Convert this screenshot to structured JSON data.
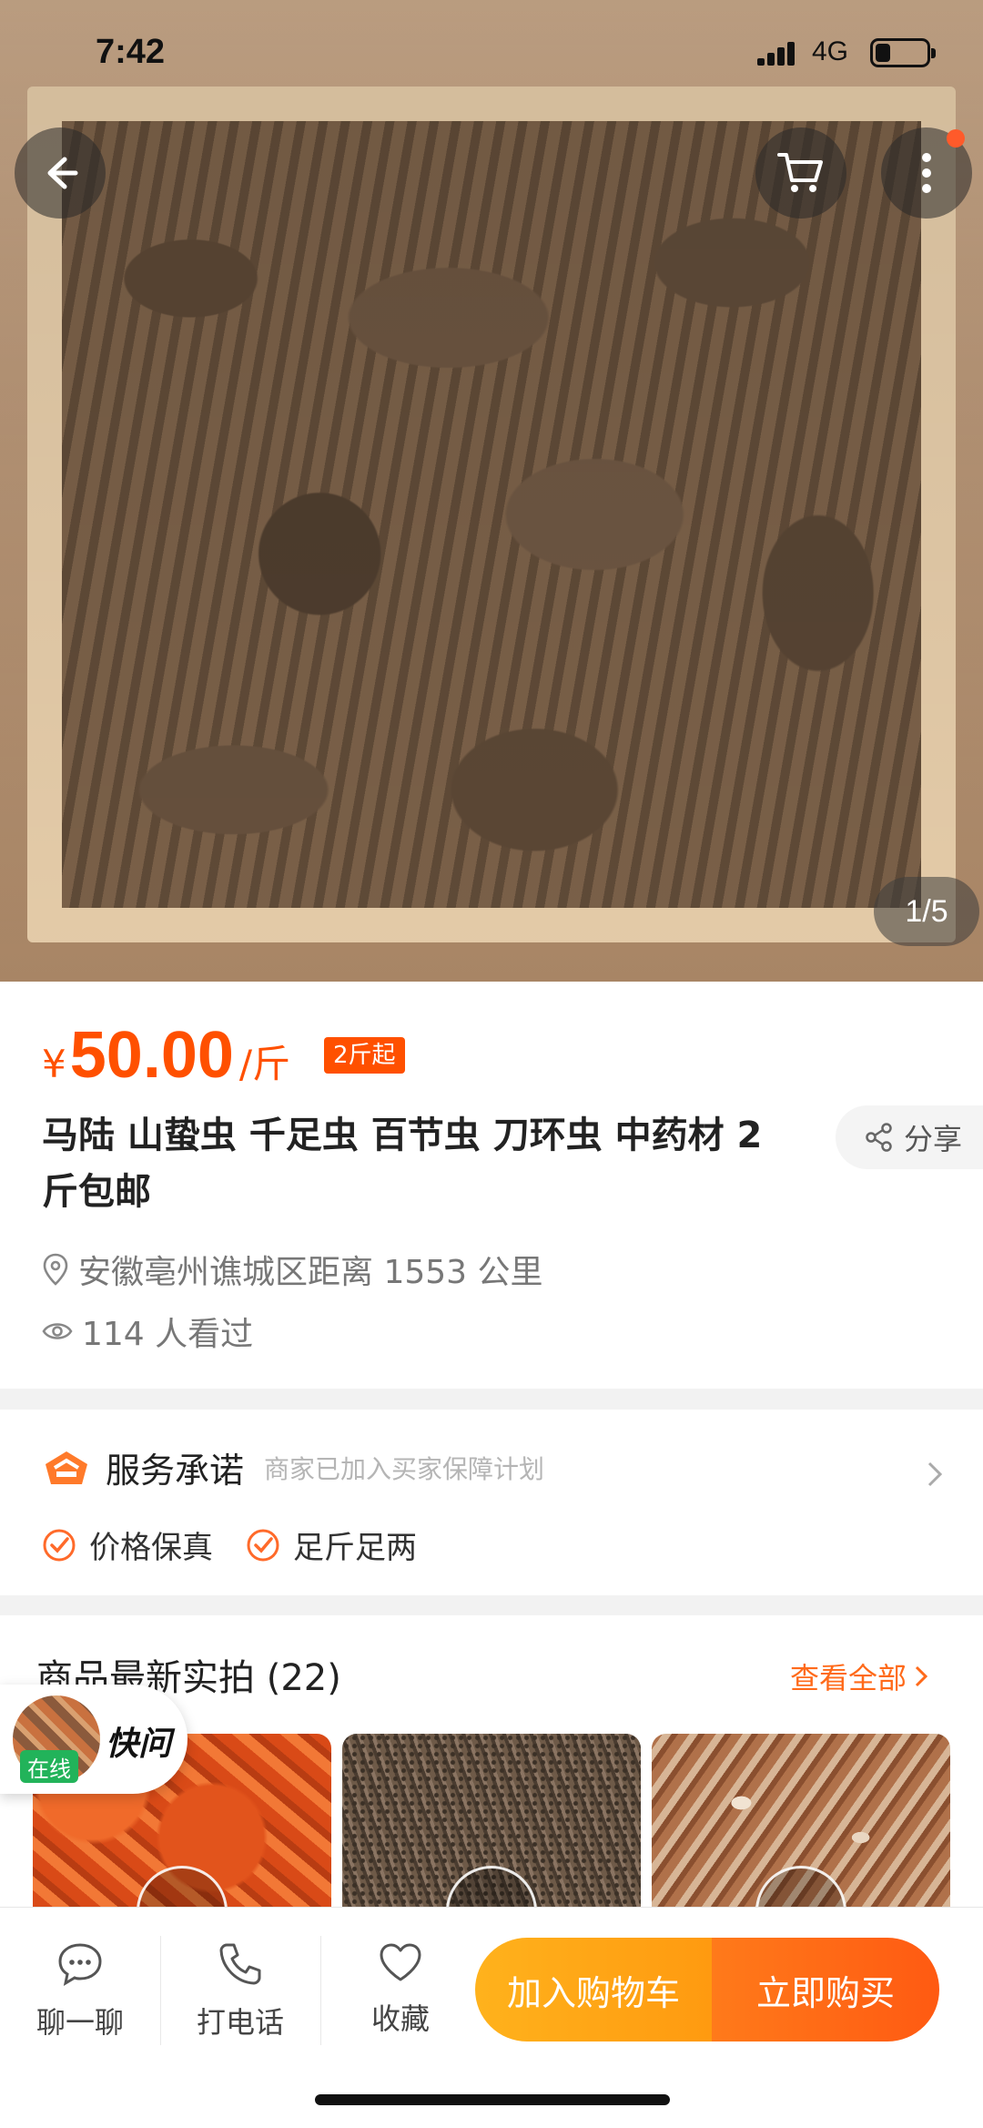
{
  "status": {
    "time": "7:42",
    "network": "4G"
  },
  "gallery": {
    "indicator": "1/5"
  },
  "product": {
    "currency": "¥",
    "price": "50.00",
    "unit": "/斤",
    "min_badge": "2斤起",
    "title": "马陆 山蛰虫 千足虫 百节虫 刀环虫 中药材 2 斤包邮",
    "share_label": "分享",
    "location": "安徽亳州谯城区距离 1553 公里",
    "views": "114 人看过"
  },
  "service": {
    "title": "服务承诺",
    "subtitle": "商家已加入买家保障计划",
    "items": [
      "价格保真",
      "足斤足两"
    ]
  },
  "photos": {
    "title": "商品最新实拍 (22)",
    "view_all": "查看全部"
  },
  "quick_ask": {
    "online": "在线",
    "label": "快问"
  },
  "bottom": {
    "chat": "聊一聊",
    "call": "打电话",
    "favorite": "收藏",
    "add_cart": "加入购物车",
    "buy_now": "立即购买"
  },
  "colors": {
    "accent": "#ff5000",
    "buy": "#ff5a12",
    "cart": "#ffa416"
  }
}
